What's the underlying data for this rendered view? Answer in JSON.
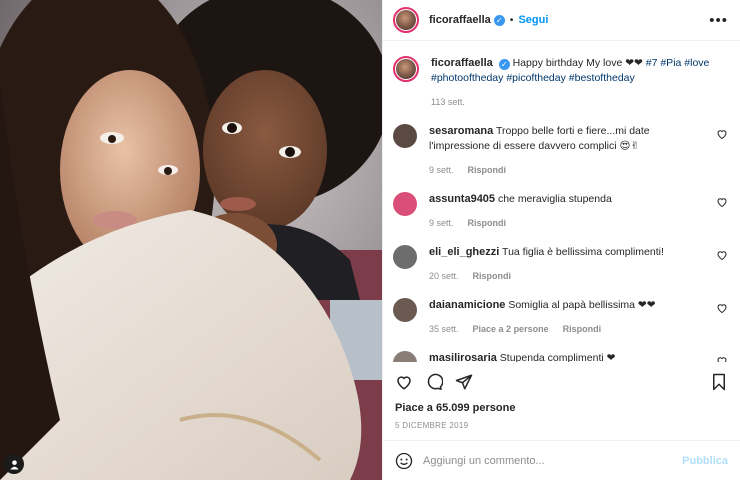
{
  "post": {
    "username": "ficoraffaella",
    "follow_label": "Segui",
    "more_label": "•••",
    "separator": "•",
    "verified_mark": "✓"
  },
  "caption": {
    "username": "ficoraffaella",
    "text": "Happy birthday My love ❤❤",
    "hashtags_line1": "#7 #Pia #love",
    "hashtags_line2": "#photooftheday #picoftheday #bestoftheday",
    "age": "113 sett."
  },
  "comments": [
    {
      "username": "sesaromana",
      "text": "Troppo belle forti e fiere...mi date l'impressione di essere davvero complici 😍✌",
      "age": "9 sett.",
      "likes": "",
      "reply": "Rispondi",
      "avatar_color": "#5b4a44"
    },
    {
      "username": "assunta9405",
      "text": "che meraviglia stupenda",
      "age": "9 sett.",
      "likes": "",
      "reply": "Rispondi",
      "avatar_color": "#d94f7a"
    },
    {
      "username": "eli_eli_ghezzi",
      "text": "Tua figlia è bellissima complimenti!",
      "age": "20 sett.",
      "likes": "",
      "reply": "Rispondi",
      "avatar_color": "#6d6d6d"
    },
    {
      "username": "daianamicione",
      "text": "Somiglia al papà bellissima ❤❤",
      "age": "35 sett.",
      "likes": "Piace a 2 persone",
      "reply": "Rispondi",
      "avatar_color": "#6b5a52"
    },
    {
      "username": "masilirosaria",
      "text": "Stupenda complimenti ❤",
      "age": "",
      "likes": "",
      "reply": "",
      "avatar_color": "#8a7d78"
    }
  ],
  "stats": {
    "likes": "Piace a 65.099 persone",
    "date": "5 DICEMBRE 2019"
  },
  "add_comment": {
    "placeholder": "Aggiungi un commento...",
    "publish_label": "Pubblica"
  },
  "icons": {
    "like": "heart-icon",
    "comment": "comment-icon",
    "share": "share-icon",
    "save": "bookmark-icon",
    "emoji": "emoji-icon",
    "tag": "user-tag-icon"
  },
  "colors": {
    "accent": "#0095f6",
    "hashtag": "#00376b",
    "muted": "#8e8e8e",
    "publish_disabled": "#b2dffc",
    "heart": "#ed4956"
  }
}
